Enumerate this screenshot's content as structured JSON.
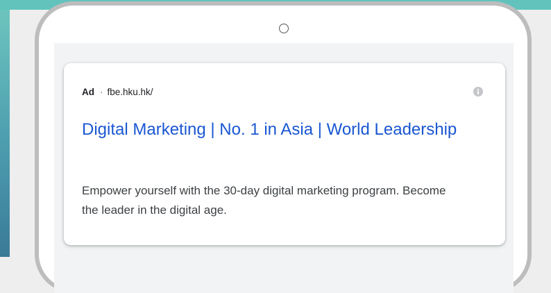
{
  "ad": {
    "badge": "Ad",
    "separator": "·",
    "display_url": "fbe.hku.hk/",
    "title": "Digital Marketing | No. 1 in Asia | World Leadership",
    "description": "Empower yourself with the 30-day digital marketing program. Become the leader in the digital age.",
    "info_icon": "info-icon"
  },
  "colors": {
    "link": "#1a57d2",
    "text": "#3c4043",
    "backdrop": "#62c3bd",
    "frame": "#bdbdbd"
  }
}
